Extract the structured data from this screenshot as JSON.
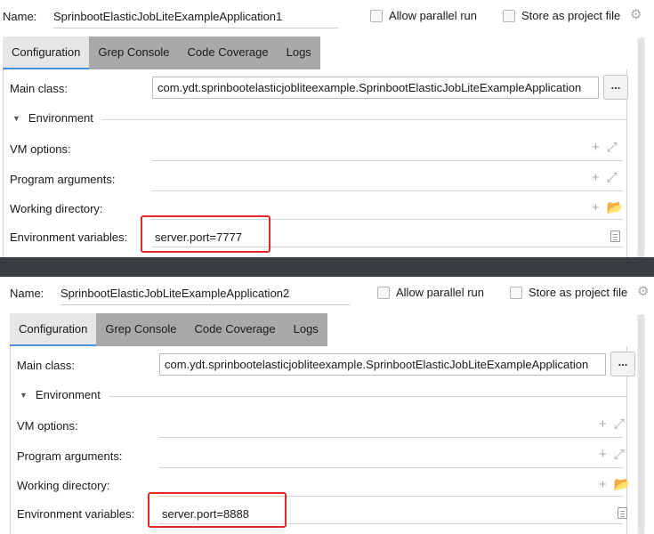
{
  "panels": [
    {
      "name_label": "Name:",
      "name_value": "SprinbootElasticJobLiteExampleApplication1",
      "allow_parallel_label": "Allow parallel run",
      "store_project_label": "Store as project file",
      "tabs": [
        {
          "label": "Configuration",
          "active": true
        },
        {
          "label": "Grep Console",
          "active": false
        },
        {
          "label": "Code Coverage",
          "active": false
        },
        {
          "label": "Logs",
          "active": false
        }
      ],
      "main_class_label": "Main class:",
      "main_class_value": "com.ydt.sprinbootelasticjobliteexample.SprinbootElasticJobLiteExampleApplication",
      "browse_label": "...",
      "environment_header": "Environment",
      "vm_options_label": "VM options:",
      "program_arguments_label": "Program arguments:",
      "working_directory_label": "Working directory:",
      "env_vars_label": "Environment variables:",
      "env_vars_value": "server.port=7777"
    },
    {
      "name_label": "Name:",
      "name_value": "SprinbootElasticJobLiteExampleApplication2",
      "allow_parallel_label": "Allow parallel run",
      "store_project_label": "Store as project file",
      "tabs": [
        {
          "label": "Configuration",
          "active": true
        },
        {
          "label": "Grep Console",
          "active": false
        },
        {
          "label": "Code Coverage",
          "active": false
        },
        {
          "label": "Logs",
          "active": false
        }
      ],
      "main_class_label": "Main class:",
      "main_class_value": "com.ydt.sprinbootelasticjobliteexample.SprinbootElasticJobLiteExampleApplication",
      "browse_label": "...",
      "environment_header": "Environment",
      "vm_options_label": "VM options:",
      "program_arguments_label": "Program arguments:",
      "working_directory_label": "Working directory:",
      "env_vars_label": "Environment variables:",
      "env_vars_value": "server.port=8888"
    }
  ],
  "icons": {
    "gear": "gear-icon",
    "add": "plus-icon",
    "expand": "expand-icon",
    "folder": "folder-icon",
    "document": "document-icon",
    "collapse": "triangle-down-icon"
  },
  "colors": {
    "tab_strip": "#a9a9a9",
    "tab_active": "#e6e6e6",
    "tab_active_underline": "#4d8fd6",
    "highlight_box": "#e02a2a",
    "separator": "#3a3d3f"
  }
}
